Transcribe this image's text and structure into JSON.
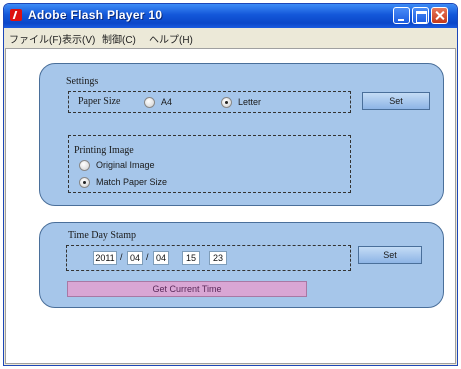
{
  "window": {
    "title": "Adobe Flash Player 10"
  },
  "menubar": {
    "items": [
      "ファイル(F)",
      "表示(V)",
      "制御(C)",
      "ヘルプ(H)"
    ]
  },
  "settings": {
    "heading": "Settings",
    "paper_size_label": "Paper Size",
    "paper_options": [
      {
        "label": "A4",
        "selected": false
      },
      {
        "label": "Letter",
        "selected": true
      }
    ],
    "set_label": "Set",
    "printing_image_label": "Printing Image",
    "image_options": [
      {
        "label": "Original Image",
        "selected": false
      },
      {
        "label": "Match Paper Size",
        "selected": true
      }
    ]
  },
  "time_stamp": {
    "heading": "Time Day Stamp",
    "year": "2011",
    "month": "04",
    "day": "04",
    "hour": "15",
    "minute": "23",
    "date_separator": "/",
    "set_label": "Set",
    "get_current_label": "Get Current Time"
  },
  "colors": {
    "panel_fill": "#a6c6ea",
    "title_bar": "#0b47c9",
    "get_time_button": "#d9a6d4"
  }
}
